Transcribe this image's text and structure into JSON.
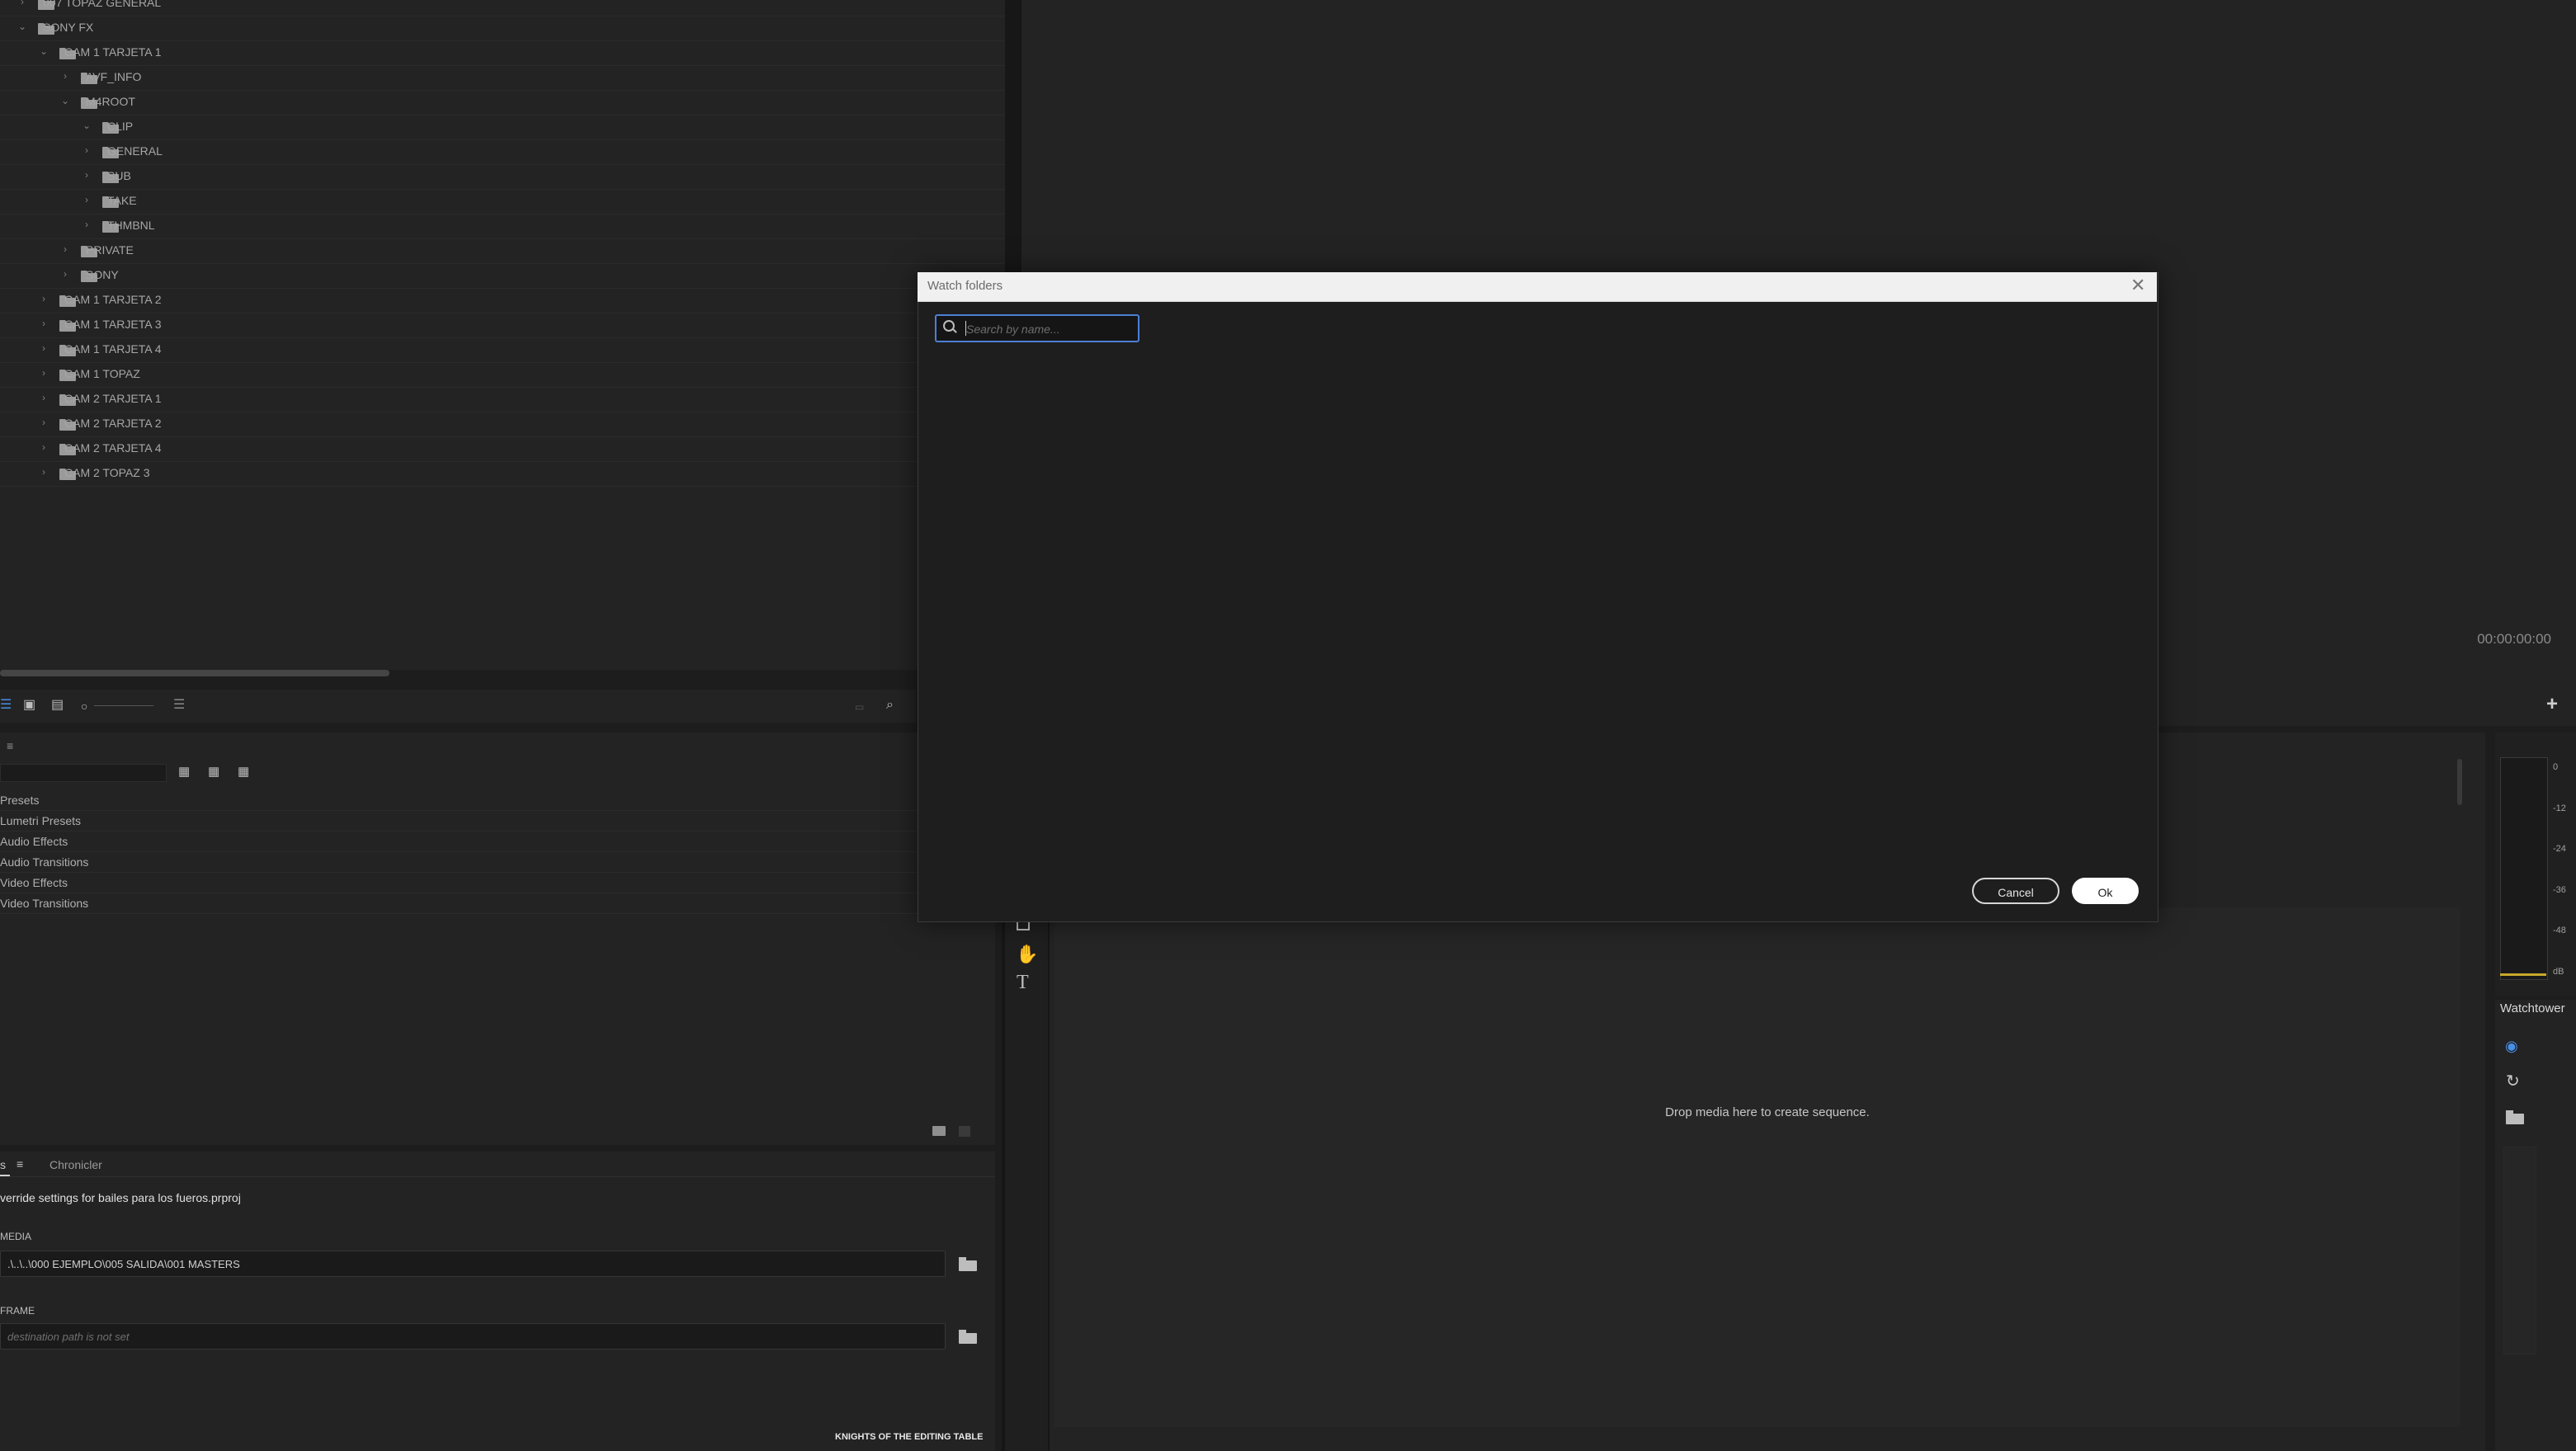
{
  "window": {
    "title": ""
  },
  "project_tree": {
    "rows": [
      {
        "label": "007 TOPAZ GENERAL",
        "depth": 0,
        "expanded": false
      },
      {
        "label": "SONY FX",
        "depth": 0,
        "expanded": true
      },
      {
        "label": "CAM 1 TARJETA 1",
        "depth": 1,
        "expanded": true
      },
      {
        "label": "AVF_INFO",
        "depth": 2,
        "expanded": false
      },
      {
        "label": "M4ROOT",
        "depth": 2,
        "expanded": true
      },
      {
        "label": "CLIP",
        "depth": 3,
        "expanded": true
      },
      {
        "label": "GENERAL",
        "depth": 3,
        "expanded": false
      },
      {
        "label": "SUB",
        "depth": 3,
        "expanded": false
      },
      {
        "label": "TAKE",
        "depth": 3,
        "expanded": false
      },
      {
        "label": "THMBNL",
        "depth": 3,
        "expanded": false
      },
      {
        "label": "PRIVATE",
        "depth": 2,
        "expanded": false
      },
      {
        "label": "SONY",
        "depth": 2,
        "expanded": false
      },
      {
        "label": "CAM 1 TARJETA 2",
        "depth": 1,
        "expanded": false
      },
      {
        "label": "CAM 1 TARJETA 3",
        "depth": 1,
        "expanded": false
      },
      {
        "label": "CAM 1 TARJETA 4",
        "depth": 1,
        "expanded": false
      },
      {
        "label": "CAM 1 TOPAZ",
        "depth": 1,
        "expanded": false
      },
      {
        "label": "CAM 2 TARJETA 1",
        "depth": 1,
        "expanded": false
      },
      {
        "label": "CAM 2 TARJETA 2",
        "depth": 1,
        "expanded": false
      },
      {
        "label": "CAM 2 TARJETA 4",
        "depth": 1,
        "expanded": false
      },
      {
        "label": "CAM 2 TOPAZ 3",
        "depth": 1,
        "expanded": false
      }
    ]
  },
  "program_monitor": {
    "timecode": "00:00:00:00",
    "add_button": "+"
  },
  "effects": {
    "menu_icon": "≡",
    "items": [
      "Presets",
      "Lumetri Presets",
      "Audio Effects",
      "Audio Transitions",
      "Video Effects",
      "Video Transitions"
    ]
  },
  "chronicler": {
    "tab_left": "s",
    "tab_menu": "≡",
    "tab_chronicler": "Chronicler",
    "override_text": "verride settings for bailes para los fueros.prproj",
    "media_label": "MEDIA",
    "media_path": ".\\..\\..\\000 EJEMPLO\\005 SALIDA\\001 MASTERS",
    "frame_label": "FRAME",
    "frame_placeholder": "destination path is not set",
    "footer": "KNIGHTS OF THE EDITING TABLE"
  },
  "timeline": {
    "drop_hint": "Drop media here to create sequence."
  },
  "audio_meter": {
    "labels": [
      "0",
      "-12",
      "-24",
      "-36",
      "-48",
      "dB"
    ],
    "meter_color": "#c7a82a"
  },
  "watchtower": {
    "title": "Watchtower",
    "icons": [
      "eye-icon",
      "refresh-icon",
      "folder-icon"
    ],
    "accent": "#4a8fe6"
  },
  "modal": {
    "title": "Watch folders",
    "search_placeholder": "Search by name...",
    "cancel_label": "Cancel",
    "ok_label": "Ok"
  }
}
